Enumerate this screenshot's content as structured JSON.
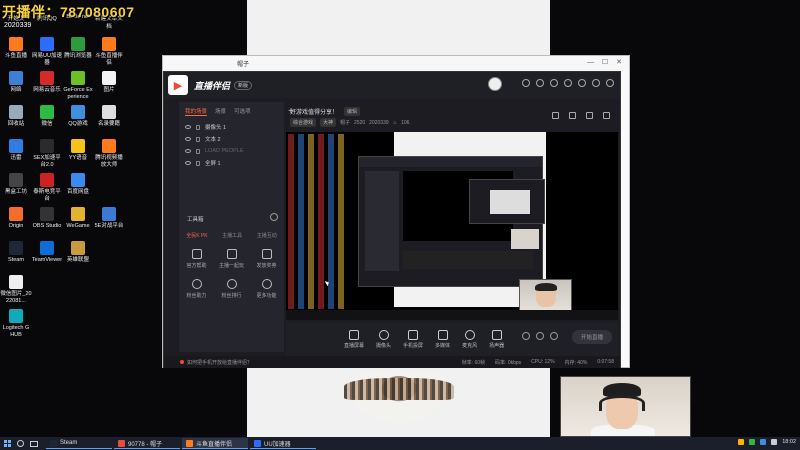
{
  "overlay": {
    "text": "开播伴：787080607",
    "sub": "2020339"
  },
  "desktop": {
    "top_labels": [
      "开始页",
      "腾讯QQ",
      "Battle.net",
      "新建文本文档"
    ],
    "icons": [
      {
        "label": "斗鱼直播",
        "color": "#ff7a1a"
      },
      {
        "label": "网易UU加速器",
        "color": "#2b6dff"
      },
      {
        "label": "腾讯浏览器",
        "color": "#2e9b3e"
      },
      {
        "label": "斗鱼直播伴侣",
        "color": "#ff7a1a"
      },
      {
        "label": "网络",
        "color": "#3d7fd6"
      },
      {
        "label": "网易云音乐",
        "color": "#d42a2a"
      },
      {
        "label": "GeForce Experience",
        "color": "#6fbf26"
      },
      {
        "label": "图片",
        "color": "#f3f3f3"
      },
      {
        "label": "回收站",
        "color": "#9ab"
      },
      {
        "label": "微信",
        "color": "#2dbb45"
      },
      {
        "label": "QQ游戏",
        "color": "#3f8ee0"
      },
      {
        "label": "名录要籍",
        "color": "#ddd"
      },
      {
        "label": "迅雷",
        "color": "#2f7de0"
      },
      {
        "label": "SEX加速平台2.0",
        "color": "#2b2b2b"
      },
      {
        "label": "YY语音",
        "color": "#f4c21a"
      },
      {
        "label": "腾讯视频播放大师",
        "color": "#ff7a1a"
      },
      {
        "label": "黑盒工坊",
        "color": "#444"
      },
      {
        "label": "泰斯电竞平台",
        "color": "#c22"
      },
      {
        "label": "百度网盘",
        "color": "#3a8bf0"
      },
      {
        "label": "",
        "color": "transparent"
      },
      {
        "label": "Origin",
        "color": "#f56c2d"
      },
      {
        "label": "OBS Studio",
        "color": "#333"
      },
      {
        "label": "WeGame",
        "color": "#e3b232"
      },
      {
        "label": "5E对战平台",
        "color": "#3a7ad5"
      },
      {
        "label": "Steam",
        "color": "#1b2838"
      },
      {
        "label": "TeamViewer",
        "color": "#0e6ed8"
      },
      {
        "label": "英雄联盟",
        "color": "#c89b3c"
      },
      {
        "label": "",
        "color": "transparent"
      },
      {
        "label": "微信图片_2022081...",
        "color": "#eee"
      },
      {
        "label": "",
        "color": "transparent"
      },
      {
        "label": "",
        "color": "transparent"
      },
      {
        "label": "",
        "color": "transparent"
      },
      {
        "label": "Logitech G HUB",
        "color": "#1ab"
      }
    ]
  },
  "bg_window": {
    "title": "帽子"
  },
  "app": {
    "name": "直播伴侣",
    "badge": "新版",
    "tabs": [
      "我的场景",
      "场景",
      "可选项"
    ],
    "layers": [
      {
        "label": "摄像头 1",
        "dim": false
      },
      {
        "label": "文本 2",
        "dim": false
      },
      {
        "label": "LOAD PEOPLE",
        "dim": true
      },
      {
        "label": "全屏 1",
        "dim": false
      }
    ],
    "toolbox_title": "工具箱",
    "tool_tabs": [
      "全民K PK",
      "主播工具",
      "主播互动"
    ],
    "tools": [
      {
        "label": "官方帮助",
        "round": false
      },
      {
        "label": "主播一起玩",
        "round": false
      },
      {
        "label": "发放奖券",
        "round": false
      },
      {
        "label": "粉丝助力",
        "round": true
      },
      {
        "label": "粉丝排行",
        "round": true
      },
      {
        "label": "更多功能",
        "round": true
      }
    ],
    "stream_title": "好游戏值得分享！",
    "edit_label": "编辑",
    "tags": [
      "综合游戏",
      "大神"
    ],
    "meta_user": "帽子",
    "meta_id": "2520",
    "meta_num": "2020339",
    "meta_count": "106",
    "bottom_buttons": [
      {
        "label": "直播屏幕",
        "round": false
      },
      {
        "label": "摄像头",
        "round": true
      },
      {
        "label": "手机投屏",
        "round": false
      },
      {
        "label": "多媒体",
        "round": false
      },
      {
        "label": "麦克风",
        "round": true
      },
      {
        "label": "扬声器",
        "round": false
      }
    ],
    "start_label": "开始直播",
    "status_text": "如何把手机开放给直播伴侣？",
    "stats": [
      "帧率: 60帧",
      "码率: 0kbps",
      "CPU: 12%",
      "内存: 40%",
      "0:07:58"
    ]
  },
  "taskbar": {
    "tasks": [
      {
        "label": "Steam",
        "color": "#1b2838",
        "active": false
      },
      {
        "label": "90778 - 帽子",
        "color": "#e84d3a",
        "active": false
      },
      {
        "label": "斗鱼直播伴侣",
        "color": "#ff7a1a",
        "active": true
      },
      {
        "label": "UU加速器",
        "color": "#2b6dff",
        "active": false
      }
    ],
    "clock": "18:02"
  }
}
